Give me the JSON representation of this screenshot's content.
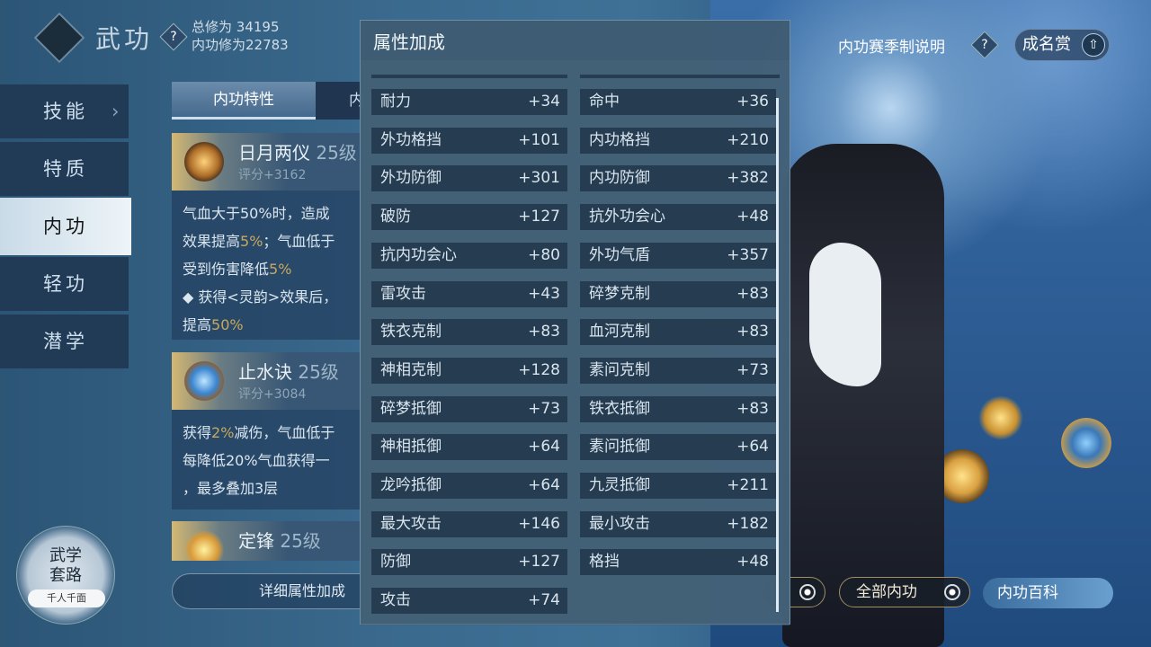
{
  "header": {
    "title": "武功",
    "help_icon": "?",
    "total_cultivation": "总修为 34195",
    "inner_cultivation": "内功修为22783"
  },
  "top_right": {
    "season_info": "内功赛季制说明",
    "help_icon": "?",
    "fame_reward": "成名赏"
  },
  "sidebar": {
    "items": [
      {
        "label": "技能"
      },
      {
        "label": "特质"
      },
      {
        "label": "内功"
      },
      {
        "label": "轻功"
      },
      {
        "label": "潜学"
      }
    ],
    "active": "内功"
  },
  "tabs": [
    {
      "label": "内功特性"
    },
    {
      "label": "内"
    }
  ],
  "skills": [
    {
      "name": "日月两仪",
      "level": "25级",
      "score": "评分+3162",
      "desc": [
        [
          "气血大于50%时，造成",
          ""
        ],
        [
          "效果提高",
          "5%",
          "；气血低于"
        ],
        [
          "受到伤害降低",
          "5%",
          ""
        ],
        [
          "◆ 获得<灵韵>效果后，",
          ""
        ],
        [
          "提高",
          "50%",
          ""
        ]
      ]
    },
    {
      "name": "止水诀",
      "level": "25级",
      "score": "评分+3084",
      "desc": [
        [
          "获得",
          "2%",
          "减伤，气血低于"
        ],
        [
          "每降低20%气血获得一",
          ""
        ],
        [
          "，最多叠加3层",
          ""
        ]
      ]
    },
    {
      "name": "定锋",
      "level": "25级"
    }
  ],
  "detail_button": "详细属性加成",
  "martial_route": {
    "title_line1": "武学",
    "title_line2": "套路",
    "subtitle": "千人千面"
  },
  "panel": {
    "title": "属性加成",
    "left": [
      {
        "label": "耐力",
        "value": "+34"
      },
      {
        "label": "外功格挡",
        "value": "+101"
      },
      {
        "label": "外功防御",
        "value": "+301"
      },
      {
        "label": "破防",
        "value": "+127"
      },
      {
        "label": "抗内功会心",
        "value": "+80"
      },
      {
        "label": "雷攻击",
        "value": "+43"
      },
      {
        "label": "铁衣克制",
        "value": "+83"
      },
      {
        "label": "神相克制",
        "value": "+128"
      },
      {
        "label": "碎梦抵御",
        "value": "+73"
      },
      {
        "label": "神相抵御",
        "value": "+64"
      },
      {
        "label": "龙吟抵御",
        "value": "+64"
      },
      {
        "label": "最大攻击",
        "value": "+146"
      },
      {
        "label": "防御",
        "value": "+127"
      },
      {
        "label": "攻击",
        "value": "+74"
      }
    ],
    "right": [
      {
        "label": "命中",
        "value": "+36"
      },
      {
        "label": "内功格挡",
        "value": "+210"
      },
      {
        "label": "内功防御",
        "value": "+382"
      },
      {
        "label": "抗外功会心",
        "value": "+48"
      },
      {
        "label": "外功气盾",
        "value": "+357"
      },
      {
        "label": "碎梦克制",
        "value": "+83"
      },
      {
        "label": "血河克制",
        "value": "+83"
      },
      {
        "label": "素问克制",
        "value": "+73"
      },
      {
        "label": "铁衣抵御",
        "value": "+83"
      },
      {
        "label": "素问抵御",
        "value": "+64"
      },
      {
        "label": "九灵抵御",
        "value": "+211"
      },
      {
        "label": "最小攻击",
        "value": "+182"
      },
      {
        "label": "格挡",
        "value": "+48"
      }
    ]
  },
  "bottom": {
    "all_inner": "全部内功",
    "encyclopedia": "内功百科"
  },
  "colors": {
    "highlight": "#c9a85c",
    "panel": "#3e5c73",
    "active_nav": "#e3edf4"
  }
}
